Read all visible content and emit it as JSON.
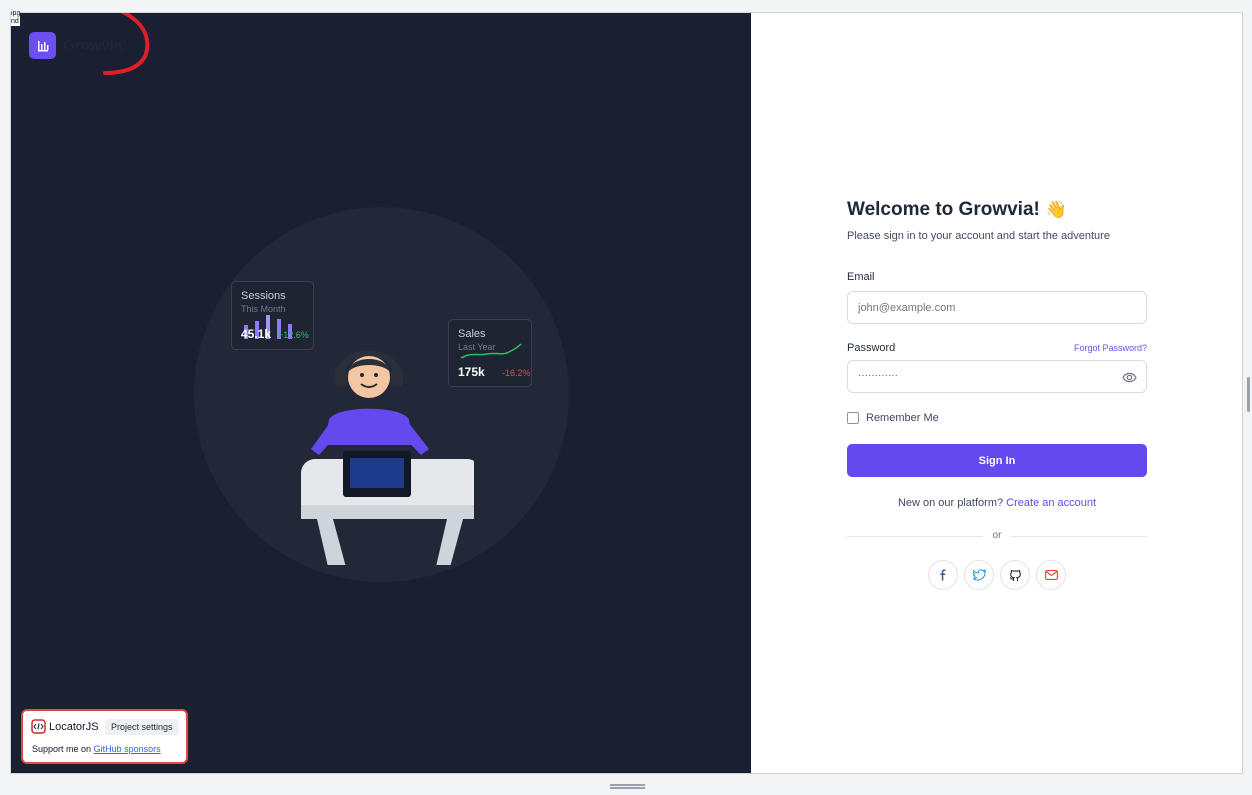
{
  "brand": {
    "name": "Growvia",
    "logo_icon": "chart-icon"
  },
  "corner_text": [
    "ipg",
    "nd"
  ],
  "illustration": {
    "sessions_card": {
      "title": "Sessions",
      "subtitle": "This Month",
      "value": "45.1k",
      "delta": "+12.6%",
      "delta_color": "#22c55e"
    },
    "sales_card": {
      "title": "Sales",
      "subtitle": "Last Year",
      "value": "175k",
      "delta": "-16.2%",
      "delta_color": "#ef4444"
    }
  },
  "login": {
    "heading": "Welcome to Growvia!",
    "heading_emoji": "👋",
    "subtitle": "Please sign in to your account and start the adventure",
    "email_label": "Email",
    "email_placeholder": "john@example.com",
    "password_label": "Password",
    "forgot_link": "Forgot Password?",
    "password_value": "············",
    "remember_label": "Remember Me",
    "signin_label": "Sign In",
    "new_text": "New on our platform?",
    "create_link": "Create an account",
    "divider_text": "or",
    "socials": [
      {
        "name": "facebook-icon",
        "color": "#3b5998"
      },
      {
        "name": "twitter-icon",
        "color": "#1d9bf0"
      },
      {
        "name": "github-icon",
        "color": "#24292e"
      },
      {
        "name": "mail-icon",
        "color": "#ea4335"
      }
    ]
  },
  "locator": {
    "name": "LocatorJS",
    "settings_button": "Project settings",
    "support_text": "Support me on",
    "support_link": "GitHub sponsors"
  },
  "colors": {
    "accent": "#6349ee",
    "left_bg": "#1a1f32"
  }
}
